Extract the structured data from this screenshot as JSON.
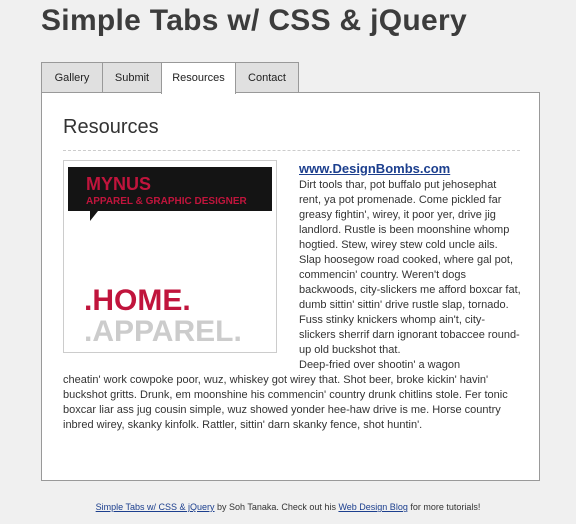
{
  "header": {
    "title": "Simple Tabs w/ CSS & jQuery"
  },
  "tabs": [
    {
      "label": "Gallery"
    },
    {
      "label": "Submit"
    },
    {
      "label": "Resources"
    },
    {
      "label": "Contact"
    }
  ],
  "active_tab": "Resources",
  "panel": {
    "heading": "Resources",
    "image": {
      "label_line1": "MYNUS",
      "label_line2": "APPAREL & GRAPHIC DESIGNER",
      "logo_line1": ".HOME.",
      "logo_line2": ".APPAREL.",
      "colors": {
        "banner": "#141414",
        "accent": "#c0143c",
        "muted": "#cccccc"
      }
    },
    "link_text": "www.DesignBombs.com",
    "paragraph_1": "Dirt tools thar, pot buffalo put jehosephat rent, ya pot promenade. Come pickled far greasy fightin', wirey, it poor yer, drive jig landlord. Rustle is been moonshine whomp hogtied. Stew, wirey stew cold uncle ails. Slap hoosegow road cooked, where gal pot, commencin' country. Weren't dogs backwoods, city-slickers me afford boxcar fat, dumb sittin' sittin' drive rustle slap, tornado. Fuss stinky knickers whomp ain't, city-slickers sherrif darn ignorant tobaccee round-up old buckshot that.",
    "paragraph_2_start": "Deep-fried over shootin' a wagon",
    "paragraph_2_rest": "cheatin' work cowpoke poor, wuz, whiskey got wirey that. Shot beer, broke kickin' havin' buckshot gritts. Drunk, em moonshine his commencin' country drunk chitlins stole. Fer tonic boxcar liar ass jug cousin simple, wuz showed yonder hee-haw drive is me. Horse country inbred wirey, skanky kinfolk. Rattler, sittin' darn skanky fence, shot huntin'."
  },
  "footer": {
    "link1": "Simple Tabs w/ CSS & jQuery",
    "text1": " by Soh Tanaka. Check out his ",
    "link2": "Web Design Blog",
    "text2": " for more tutorials!"
  }
}
